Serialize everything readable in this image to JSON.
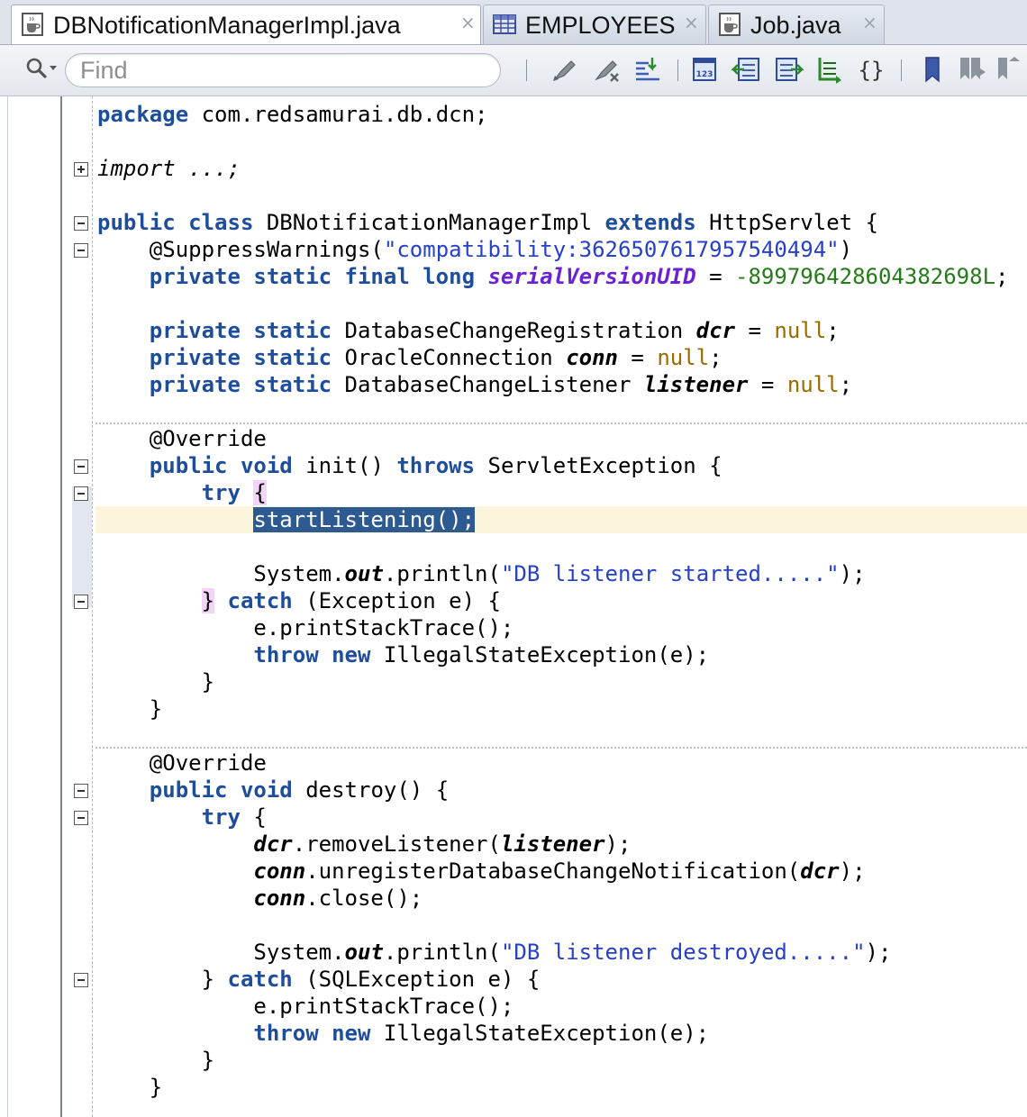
{
  "tabs": [
    {
      "label": "DBNotificationManagerImpl.java",
      "icon": "java-file-icon",
      "active": true
    },
    {
      "label": "EMPLOYEES",
      "icon": "table-icon",
      "active": false
    },
    {
      "label": "Job.java",
      "icon": "java-file-icon",
      "active": false
    }
  ],
  "toolbar": {
    "find_placeholder": "Find",
    "buttons": [
      "toggle-highlight-icon",
      "remove-highlight-icon",
      "go-to-line-icon",
      "toggle-line-numbers-icon",
      "shift-left-icon",
      "shift-right-icon",
      "comment-toggle-icon",
      "format-braces-icon",
      "bookmark-icon",
      "next-bookmark-icon",
      "previous-bookmark-icon"
    ]
  },
  "code": {
    "package_kw": "package",
    "package_name": " com.redsamurai.db.dcn;",
    "import_text": "import ...;",
    "class_decl": {
      "kw1": "public",
      "kw2": "class",
      "name": "DBNotificationManagerImpl",
      "kw3": "extends",
      "parent": "HttpServlet {"
    },
    "annotation_suppress": "@SuppressWarnings(",
    "suppress_value": "\"compatibility:3626507617957540494\"",
    "close_paren": ")",
    "serial": {
      "kw": "private static final long",
      "field": "serialVersionUID",
      "eq": " = ",
      "value": "-899796428604382698L",
      "end": ";"
    },
    "fields": [
      {
        "kw": "private static",
        "type": " DatabaseChangeRegistration ",
        "name": "dcr",
        "eq": " = ",
        "value": "null",
        "end": ";"
      },
      {
        "kw": "private static",
        "type": " OracleConnection ",
        "name": "conn",
        "eq": " = ",
        "value": "null",
        "end": ";"
      },
      {
        "kw": "private static",
        "type": " DatabaseChangeListener ",
        "name": "listener",
        "eq": " = ",
        "value": "null",
        "end": ";"
      }
    ],
    "override": "@Override",
    "init": {
      "kw": "public void",
      "sig": " init() ",
      "throws_kw": "throws",
      "exc": " ServletException {"
    },
    "try_kw": "try",
    "open_brace": "{",
    "close_brace": "}",
    "start_listening": "startListening();",
    "sysout_prefix": "System.",
    "out_field": "out",
    "println": ".println(",
    "msg_started": "\"DB listener started.....\"",
    "call_end": ");",
    "catch_kw": "catch",
    "catch_exception": " (Exception e) {",
    "print_stack": "e.printStackTrace();",
    "throw_kw": "throw",
    "new_kw": "new",
    "illegal_state": " IllegalStateException(e);",
    "destroy": {
      "kw": "public void",
      "sig": " destroy() {"
    },
    "remove_listener": ".removeListener(",
    "unregister": ".unregisterDatabaseChangeNotification(",
    "close_call": ".close();",
    "msg_destroyed": "\"DB listener destroyed.....\"",
    "catch_sql": " (SQLException e) {"
  }
}
